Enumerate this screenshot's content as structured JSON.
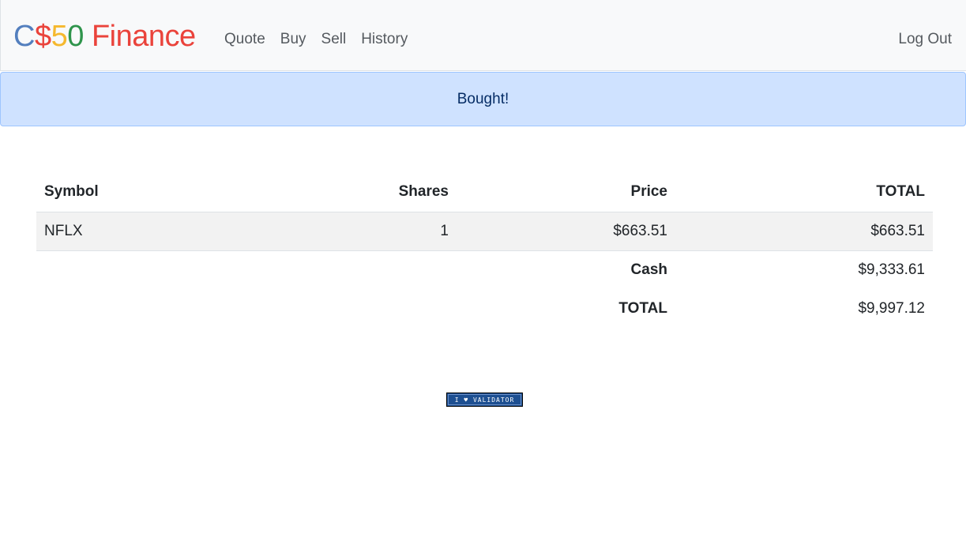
{
  "brand": {
    "c": "C",
    "dollar": "$",
    "five": "5",
    "zero": "0",
    "finance": "Finance"
  },
  "nav": {
    "links": [
      "Quote",
      "Buy",
      "Sell",
      "History"
    ],
    "logout": "Log Out"
  },
  "alert": {
    "message": "Bought!"
  },
  "table": {
    "headers": [
      "Symbol",
      "Shares",
      "Price",
      "TOTAL"
    ],
    "rows": [
      {
        "symbol": "NFLX",
        "shares": "1",
        "price": "$663.51",
        "total": "$663.51"
      }
    ],
    "cash_label": "Cash",
    "cash_value": "$9,333.61",
    "grand_total_label": "TOTAL",
    "grand_total_value": "$9,997.12"
  },
  "footer": {
    "validator_label": "I ♥ VALIDATOR"
  },
  "colors": {
    "brand_blue": "#537fbe",
    "brand_red": "#ea433b",
    "brand_yellow": "#f5b82e",
    "brand_green": "#2e944b",
    "alert_bg": "#cfe2ff"
  }
}
